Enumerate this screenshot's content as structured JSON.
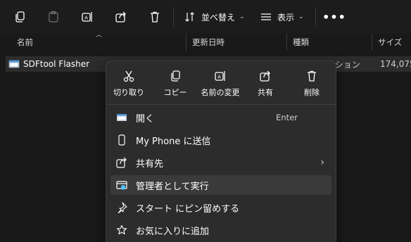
{
  "toolbar": {
    "sort_label": "並べ替え",
    "view_label": "表示",
    "more_label": "•••"
  },
  "columns": {
    "name": "名前",
    "modified": "更新日時",
    "type": "種類",
    "size": "サイズ"
  },
  "file": {
    "name": "SDFtool Flasher",
    "type": "アプリケーション",
    "size": "174,075"
  },
  "context_menu": {
    "quick_actions": [
      {
        "label": "切り取り",
        "icon": "cut-icon"
      },
      {
        "label": "コピー",
        "icon": "copy-icon"
      },
      {
        "label": "名前の変更",
        "icon": "rename-icon"
      },
      {
        "label": "共有",
        "icon": "share-icon"
      },
      {
        "label": "削除",
        "icon": "delete-icon"
      }
    ],
    "items": [
      {
        "label": "開く",
        "shortcut": "Enter",
        "icon": "open-icon"
      },
      {
        "label": "My Phone に送信",
        "icon": "phone-icon"
      },
      {
        "label": "共有先",
        "icon": "share-icon",
        "has_submenu": true
      },
      {
        "label": "管理者として実行",
        "icon": "shield-icon",
        "highlighted": true
      },
      {
        "label": "スタート にピン留めする",
        "icon": "pin-icon"
      },
      {
        "label": "お気に入りに追加",
        "icon": "star-icon"
      }
    ]
  },
  "colors": {
    "background": "#191919",
    "menu_background": "#2c2c2c",
    "accent": "#4cc2ff"
  }
}
